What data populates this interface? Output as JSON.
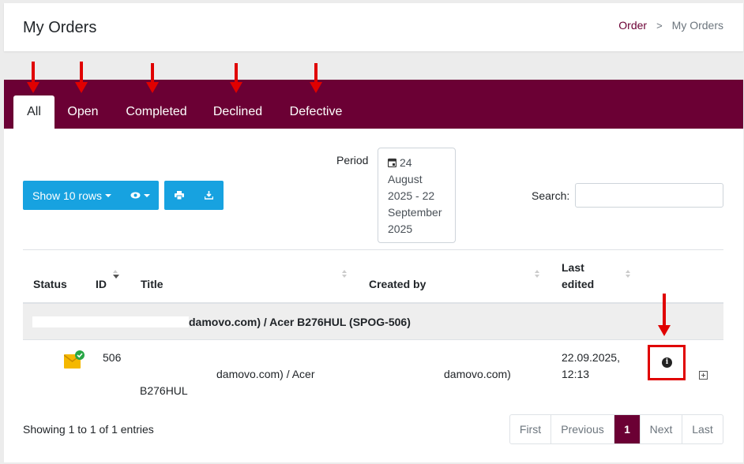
{
  "header": {
    "title": "My Orders",
    "breadcrumb": {
      "link": "Order",
      "separator": ">",
      "current": "My Orders"
    }
  },
  "tabs": [
    {
      "label": "All",
      "active": true
    },
    {
      "label": "Open",
      "active": false
    },
    {
      "label": "Completed",
      "active": false
    },
    {
      "label": "Declined",
      "active": false
    },
    {
      "label": "Defective",
      "active": false
    }
  ],
  "toolbar": {
    "rows_button": "Show 10 rows",
    "columns_icon": "eye-icon",
    "print_icon": "print-icon",
    "download_icon": "download-icon",
    "period_label": "Period",
    "period_lines": [
      "24",
      "August",
      "2025 - 22",
      "September",
      "2025"
    ],
    "search_label": "Search:",
    "search_value": ""
  },
  "table": {
    "headers": {
      "status": "Status",
      "id": "ID",
      "title": "Title",
      "created_by": "Created by",
      "last_edited_1": "Last",
      "last_edited_2": "edited"
    },
    "group_row": "damovo.com) / Acer B276HUL (SPOG-506)",
    "rows": [
      {
        "status_icon": "envelope-check-icon",
        "id": "506",
        "title_line1": "damovo.com) / Acer",
        "title_line2": "B276HUL",
        "created_by": "damovo.com)",
        "last_edited_1": "22.09.2025,",
        "last_edited_2": "12:13",
        "info_icon": "info-icon",
        "expand_icon": "expand-icon"
      }
    ]
  },
  "footer": {
    "info": "Showing 1 to 1 of 1 entries",
    "pagination": [
      "First",
      "Previous",
      "1",
      "Next",
      "Last"
    ],
    "current_page": "1"
  },
  "colors": {
    "brand": "#6b0034",
    "button": "#17a2e0",
    "annotation": "#e00000"
  }
}
